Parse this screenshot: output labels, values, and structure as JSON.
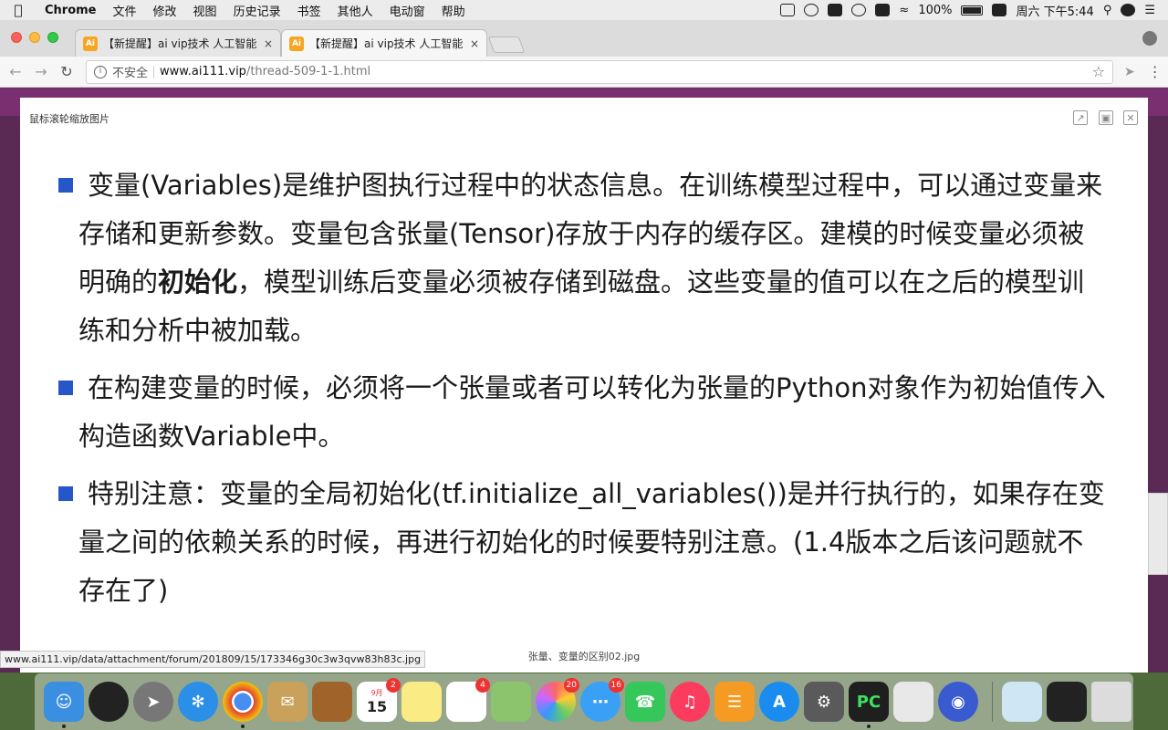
{
  "menubar": {
    "app_name": "Chrome",
    "menus": [
      "文件",
      "修改",
      "视图",
      "历史记录",
      "书签",
      "其他人",
      "电动窗",
      "帮助"
    ],
    "battery": "100%",
    "clock": "周六 下午5:44"
  },
  "tabs": [
    {
      "favicon": "Ai",
      "title": "【新提醒】ai vip技术 人工智能 技术",
      "close": "×"
    },
    {
      "favicon": "Ai",
      "title": "【新提醒】ai vip技术 人工智能 技术",
      "close": "×"
    }
  ],
  "toolbar": {
    "security_label": "不安全",
    "url_host": "www.ai111.vip",
    "url_path": "/thread-509-1-1.html"
  },
  "lightbox": {
    "hint": "鼠标滚轮缩放图片",
    "caption": "张量、变量的区别02.jpg",
    "bullets": [
      {
        "before": "变量(Variables)是维护图执行过程中的状态信息。在训练模型过程中，可以通过变量来存储和更新参数。变量包含张量(Tensor)存放于内存的缓存区。建模的时候变量必须被明确的",
        "bold": "初始化",
        "after": "，模型训练后变量必须被存储到磁盘。这些变量的值可以在之后的模型训练和分析中被加载。"
      },
      {
        "before": "在构建变量的时候，必须将一个张量或者可以转化为张量的Python对象作为初始值传入构造函数Variable中。",
        "bold": "",
        "after": ""
      },
      {
        "before": "特别注意：变量的全局初始化(tf.initialize_all_variables())是并行执行的，如果存在变量之间的依赖关系的时候，再进行初始化的时候要特别注意。(1.4版本之后该问题就不存在了)",
        "bold": "",
        "after": ""
      }
    ]
  },
  "status_url": "www.ai111.vip/data/attachment/forum/201809/15/173346g30c3w3qvw83h83c.jpg",
  "dock": {
    "calendar_month": "9月",
    "calendar_day": "15",
    "badges": {
      "calendar": "2",
      "reminders": "4",
      "photos": "20",
      "messages": "16"
    }
  },
  "colors": {
    "bullet": "#2657c9",
    "accent_tab_favicon": "#f5a623"
  }
}
